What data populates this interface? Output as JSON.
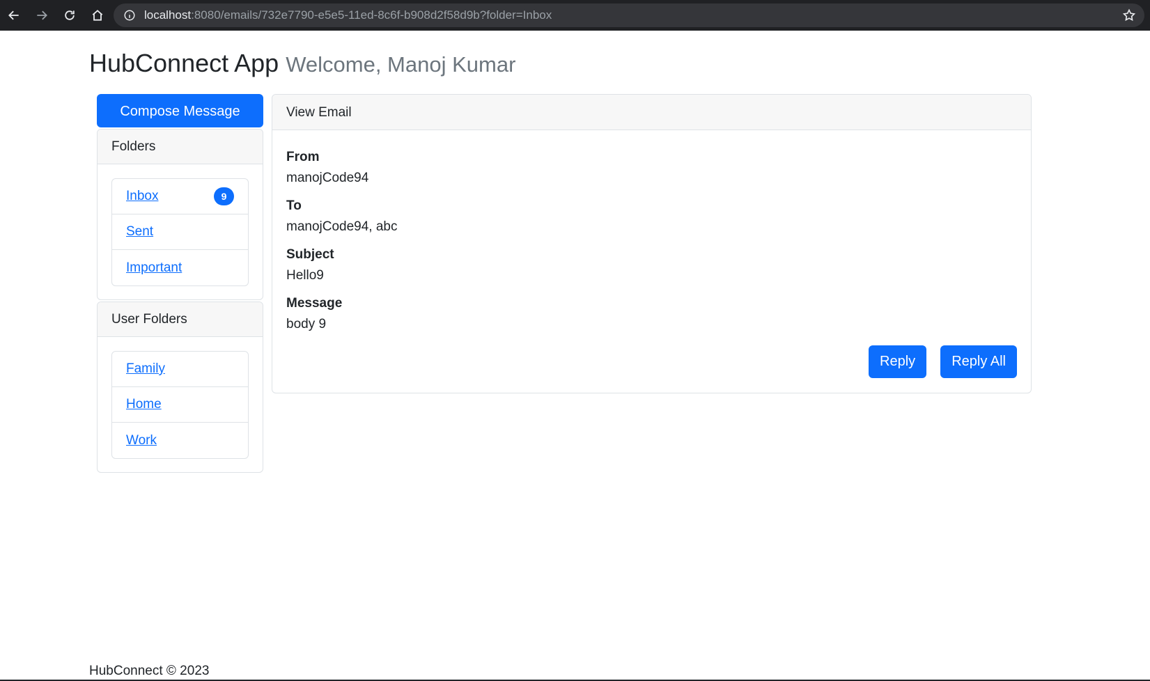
{
  "browser": {
    "url_host": "localhost",
    "url_rest": ":8080/emails/732e7790-e5e5-11ed-8c6f-b908d2f58d9b?folder=Inbox"
  },
  "header": {
    "app_title": "HubConnect App",
    "welcome": "Welcome, Manoj Kumar"
  },
  "sidebar": {
    "compose_label": "Compose Message",
    "folders_title": "Folders",
    "folders": [
      {
        "label": "Inbox",
        "badge": "9"
      },
      {
        "label": "Sent"
      },
      {
        "label": "Important"
      }
    ],
    "user_folders_title": "User Folders",
    "user_folders": [
      {
        "label": "Family"
      },
      {
        "label": "Home"
      },
      {
        "label": "Work"
      }
    ]
  },
  "email": {
    "card_title": "View Email",
    "from_label": "From",
    "from_value": "manojCode94",
    "to_label": "To",
    "to_value": "manojCode94, abc",
    "subject_label": "Subject",
    "subject_value": "Hello9",
    "message_label": "Message",
    "message_value": "body 9",
    "reply_label": "Reply",
    "reply_all_label": "Reply All"
  },
  "footer": {
    "text": "HubConnect © 2023"
  },
  "colors": {
    "primary": "#0d6efd",
    "chrome_bg": "#202124"
  },
  "icons": [
    "back-icon",
    "forward-icon",
    "reload-icon",
    "home-icon",
    "info-icon",
    "star-icon"
  ]
}
